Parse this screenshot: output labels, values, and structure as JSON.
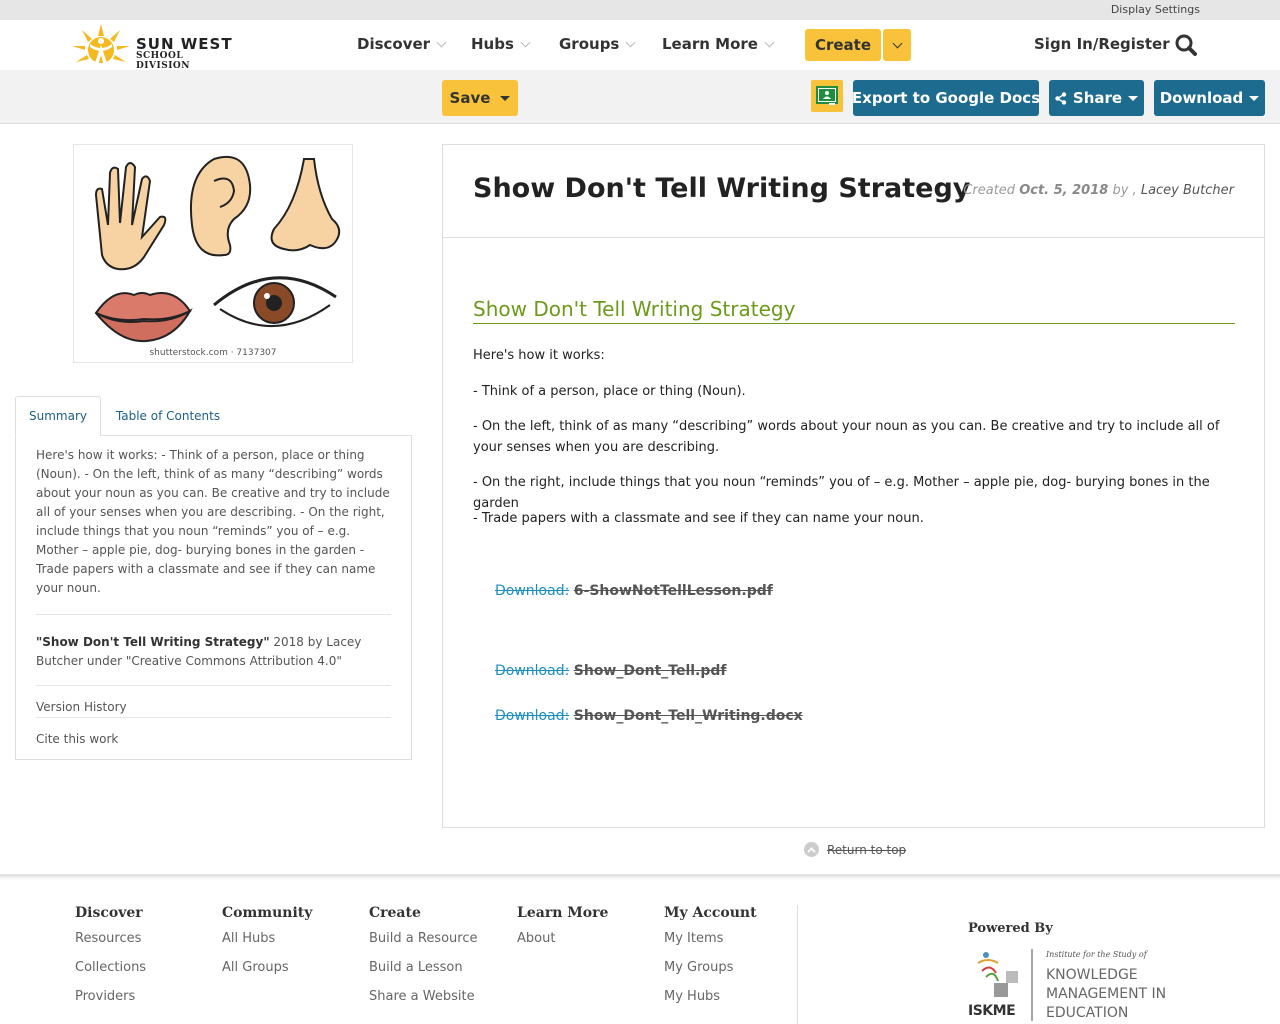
{
  "utility": {
    "display_settings": "Display Settings"
  },
  "brand": {
    "line1": "SUN WEST",
    "line2": "SCHOOL DIVISION",
    "color": "#f4b820"
  },
  "nav": {
    "items": [
      {
        "label": "Discover"
      },
      {
        "label": "Hubs"
      },
      {
        "label": "Groups"
      },
      {
        "label": "Learn More"
      }
    ],
    "create": "Create",
    "sign_in": "Sign In/Register"
  },
  "toolbar": {
    "save": "Save",
    "export": "Export to Google Docs",
    "share": "Share",
    "download": "Download"
  },
  "thumbnail": {
    "caption": "shutterstock.com · 7137307"
  },
  "tabs": [
    {
      "label": "Summary"
    },
    {
      "label": "Table of Contents"
    }
  ],
  "summary": {
    "text": "Here's how it works: - Think of a person, place or thing (Noun). - On the left, think of as many “describing” words about your noun as you can. Be creative and try to include all of your senses when you are describing. - On the right, include things that you noun “reminds” you of – e.g. Mother – apple pie, dog- burying bones in the garden - Trade papers with a classmate and see if they can name your noun.",
    "attribution_title": "\"Show Don't Tell Writing Strategy\"",
    "attribution_rest": " 2018 by Lacey Butcher under \"Creative Commons Attribution 4.0\"",
    "version_history": "Version History",
    "cite": "Cite this work"
  },
  "resource": {
    "title": "Show Don't Tell Writing Strategy",
    "created_label": "Created",
    "created_date": "Oct. 5, 2018",
    "by": "by ,",
    "author": "Lacey Butcher",
    "section_heading": "Show Don't Tell Writing Strategy",
    "paragraphs": [
      "Here's how it works:",
      "- Think of a person, place or thing (Noun).",
      "- On the left, think of as many “describing” words about your noun as you can.  Be creative and try to include all of your senses when you are describing.",
      "- On the right, include things that you noun “reminds” you of – e.g. Mother – apple pie, dog- burying bones in the garden",
      "- Trade papers with a classmate and see if they can name your noun."
    ],
    "downloads": [
      {
        "prefix": "Download:",
        "file": "6-ShowNotTellLesson.pdf"
      },
      {
        "prefix": "Download:",
        "file": "Show_Dont_Tell.pdf"
      },
      {
        "prefix": "Download:",
        "file": "Show_Dont_Tell_Writing.docx"
      }
    ],
    "return_top": "Return to top"
  },
  "footer": {
    "columns": [
      {
        "heading": "Discover",
        "links": [
          "Resources",
          "Collections",
          "Providers"
        ]
      },
      {
        "heading": "Community",
        "links": [
          "All Hubs",
          "All Groups"
        ]
      },
      {
        "heading": "Create",
        "links": [
          "Build a Resource",
          "Build a Lesson",
          "Share a Website"
        ]
      },
      {
        "heading": "Learn More",
        "links": [
          "About"
        ]
      },
      {
        "heading": "My Account",
        "links": [
          "My Items",
          "My Groups",
          "My Hubs"
        ]
      }
    ],
    "powered_by": "Powered By",
    "iskme": {
      "tagline": "Institute for the Study of",
      "line1": "KNOWLEDGE",
      "line2": "MANAGEMENT IN",
      "line3": "EDUCATION",
      "abbr": "ISKME"
    }
  },
  "colors": {
    "accent": "#f8c33a",
    "teal": "#1d6b8f",
    "heading_green": "#6d9a1a",
    "link_blue": "#1d8fbd"
  }
}
